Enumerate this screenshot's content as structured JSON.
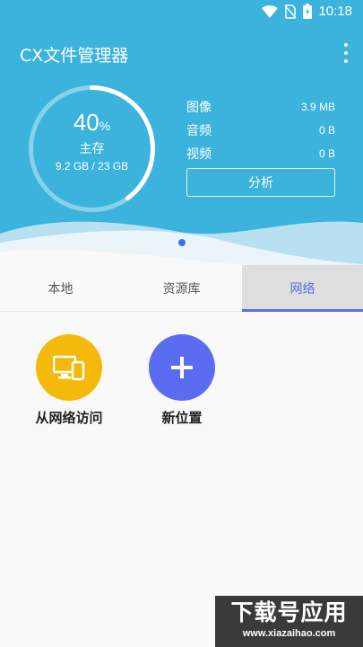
{
  "status_bar": {
    "time": "10:18"
  },
  "app": {
    "title": "CX文件管理器"
  },
  "storage": {
    "percent": "40",
    "percent_unit": "%",
    "percent_fraction": 0.4,
    "label": "主存",
    "usage": "9.2 GB / 23 GB"
  },
  "stats": [
    {
      "name": "图像",
      "value": "3.9 MB"
    },
    {
      "name": "音频",
      "value": "0 B"
    },
    {
      "name": "视频",
      "value": "0 B"
    }
  ],
  "analyze_label": "分析",
  "tabs": [
    {
      "label": "本地",
      "active": false
    },
    {
      "label": "资源库",
      "active": false
    },
    {
      "label": "网络",
      "active": true
    }
  ],
  "network_items": [
    {
      "label": "从网络访问",
      "icon": "devices-icon",
      "color": "#f5b90c"
    },
    {
      "label": "新位置",
      "icon": "plus-icon",
      "color": "#5a6df0"
    }
  ],
  "watermark": {
    "main": "下载号应用",
    "sub": "www.xiazaihao.com"
  },
  "colors": {
    "header": "#3bb3dd",
    "accent": "#5a6de6"
  }
}
